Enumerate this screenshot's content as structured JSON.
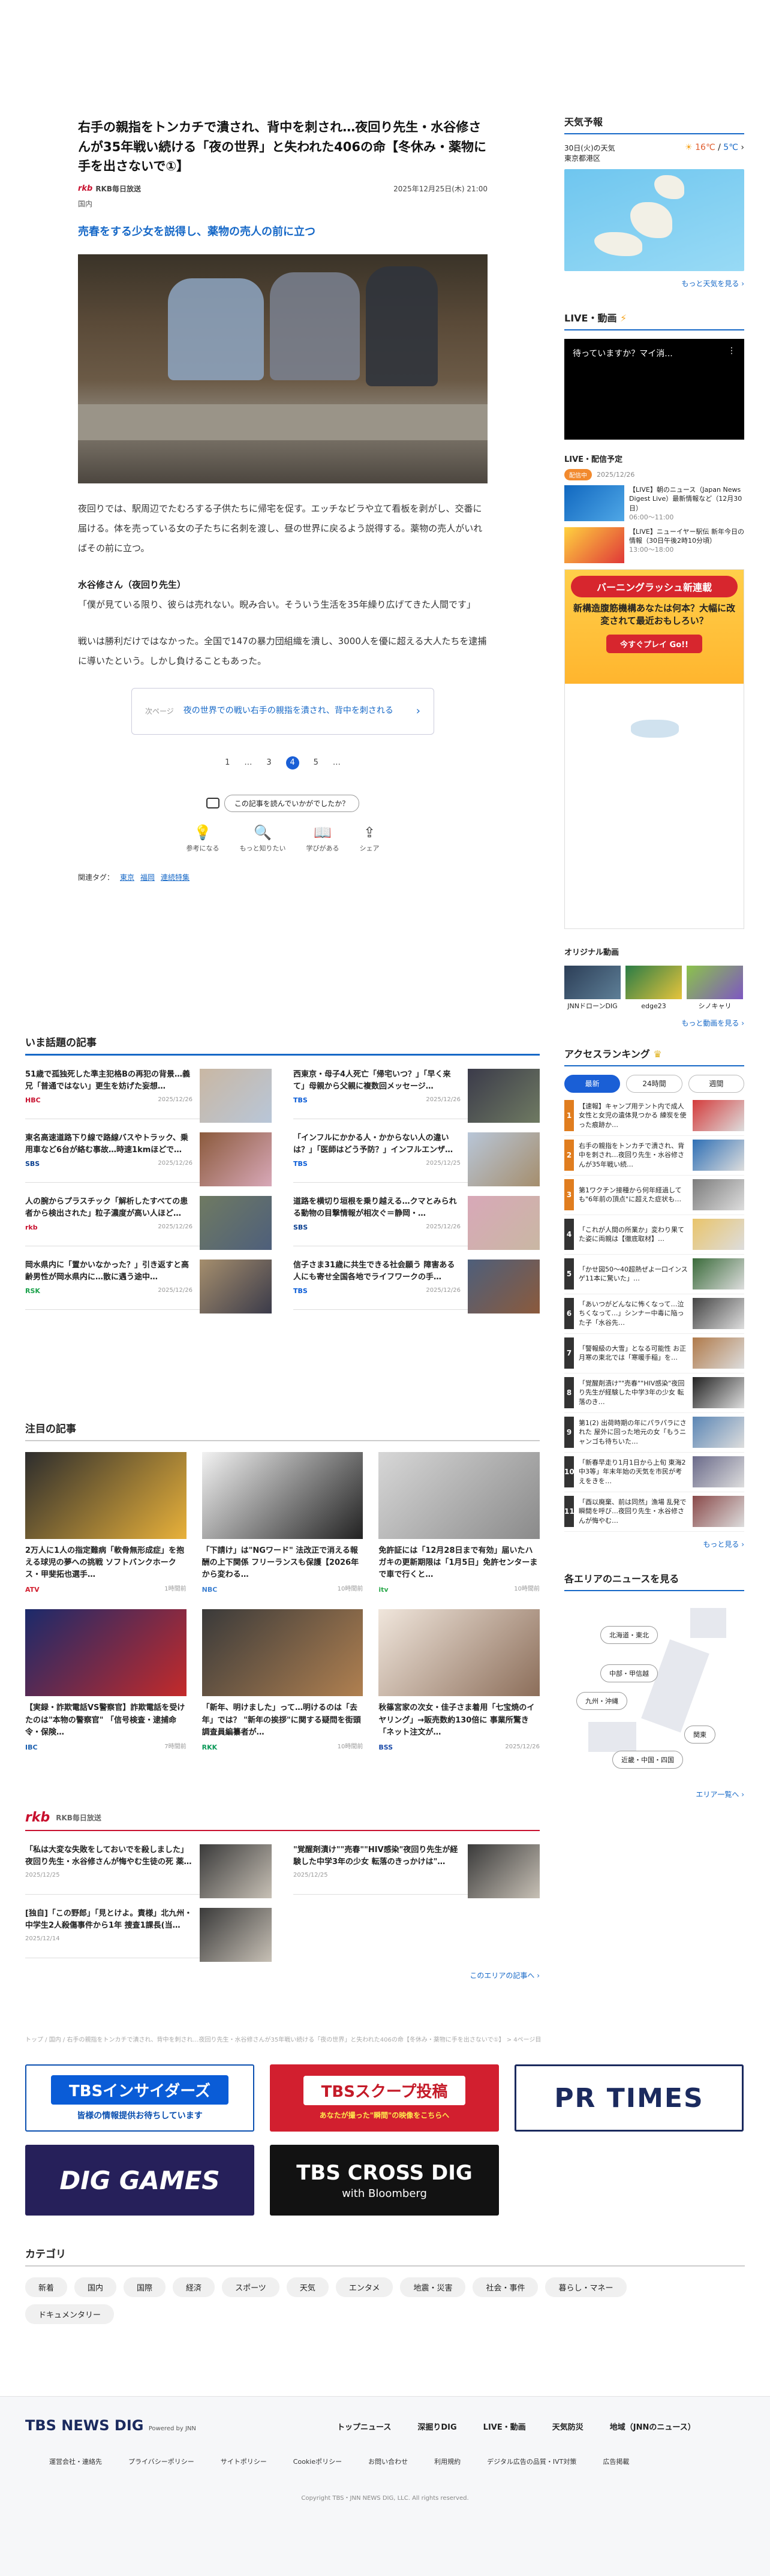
{
  "article": {
    "title": "右手の親指をトンカチで潰され、背中を刺され…夜回り先生・水谷修さんが35年戦い続ける「夜の世界」と失われた406の命【冬休み・薬物に手を出さないで①】",
    "source": "RKB毎日放送",
    "source_logo": "rkb",
    "date": "2025年12月25日(木) 21:00",
    "category": "国内",
    "subheading": "売春をする少女を説得し、薬物の売人の前に立つ",
    "paragraphs": [
      "夜回りでは、駅周辺でたむろする子供たちに帰宅を促す。エッチなビラや立て看板を剥がし、交番に届ける。体を売っている女の子たちに名刺を渡し、昼の世界に戻るよう説得する。薬物の売人がいればその前に立つ。",
      "「僕が見ている限り、彼らは売れない。睨み合い。そういう生活を35年繰り広げてきた人間です」",
      "戦いは勝利だけではなかった。全国で147の暴力団組織を潰し、3000人を優に超える大人たちを逮捕に導いたという。しかし負けることもあった。"
    ],
    "speaker": "水谷修さん（夜回り先生）",
    "next_label": "次ページ",
    "next_text": "夜の世界での戦い右手の親指を潰され、背中を刺される",
    "pages": [
      "1",
      "…",
      "3",
      "4",
      "5",
      "…"
    ],
    "current_page": "4",
    "reaction_q": "この記事を読んでいかがでしたか？",
    "reactions": [
      "参考になる",
      "もっと知りたい",
      "学びがある",
      "シェア"
    ],
    "tags_label": "関連タグ：",
    "tags": [
      "東京",
      "福岡",
      "連続特集"
    ]
  },
  "trending": {
    "title": "いま話題の記事",
    "items": [
      {
        "text": "51歳で孤独死した準主犯格Bの再犯の背景…義兄「普通ではない」更生を妨げた妄想…",
        "brand": "HBC",
        "date": "2025/12/26"
      },
      {
        "text": "西東京・母子4人死亡「帰宅いつ？」「早く来て」母親から父親に複数回メッセージ…",
        "brand": "TBS",
        "date": "2025/12/26"
      },
      {
        "text": "東名高速道路下り線で路線バスやトラック、乗用車など6台が絡む事故…時速1kmほどで…",
        "brand": "SBS",
        "date": "2025/12/26"
      },
      {
        "text": "「インフルにかかる人・かからない人の違いは？」「医師はどう予防？」インフルエンザ…",
        "brand": "TBS",
        "date": "2025/12/25"
      },
      {
        "text": "人の腕からプラスチック「解析したすべての患者から検出された」粒子濃度が高い人ほど…",
        "brand": "rkb",
        "date": "2025/12/26"
      },
      {
        "text": "道路を横切り垣根を乗り越える…クマとみられる動物の目撃情報が相次ぐ＝静岡・…",
        "brand": "SBS",
        "date": "2025/12/26"
      },
      {
        "text": "岡水県内に「置かいなかった？」引き返すと高齢男性が岡水県内に…散に遇う途中…",
        "brand": "RSK",
        "date": "2025/12/26"
      },
      {
        "text": "信子さま31歳に共生できる社会願う 障害ある人にも寄せ全国各地でライフワークの手…",
        "brand": "TBS",
        "date": "2025/12/26"
      }
    ]
  },
  "featured": {
    "title": "注目の記事",
    "items": [
      {
        "text": "2万人に1人の指定難病「軟骨無形成症」を抱える球児の夢への挑戦 ソフトバンクホークス・甲斐拓也選手…",
        "brand": "ATV",
        "date": "1時間前"
      },
      {
        "text": "「下請け」は\"NGワード\" 法改正で消える報酬の上下関係 フリーランスも保護【2026年から変わる…",
        "brand": "NBC",
        "date": "10時間前"
      },
      {
        "text": "免許証には「12月28日まで有効」届いたハガキの更新期限は「1月5日」免許センターまで車で行くと…",
        "brand": "itv",
        "date": "10時間前"
      },
      {
        "text": "【実録・詐欺電話VS警察官】詐欺電話を受けたのは\"本物の警察官\" 「信号検査・逮捕命令・保険…",
        "brand": "IBC",
        "date": "7時間前"
      },
      {
        "text": "「新年、明けました」って…明けるのは「去年」では？ \"新年の挨拶\"に関する疑問を街頭調査員編纂者が…",
        "brand": "RKK",
        "date": "10時間前"
      },
      {
        "text": "秋篠宮家の次女・佳子さま着用「七宝焼のイヤリング」→販売数約130倍に 事業所驚き「ネット注文が…",
        "brand": "BSS",
        "date": "2025/12/26"
      }
    ]
  },
  "rkb_section": {
    "label": "RKB毎日放送",
    "items": [
      {
        "text": "「私は大変な失敗をしておいでを殺しました」夜回り先生・水谷修さんが悔やむ生徒の死 薬…",
        "date": "2025/12/25"
      },
      {
        "text": "\"覚醒剤漬け\"\"売春\"\"HIV感染\"夜回り先生が経験した中学3年の少女 転落のきっかけは\"…",
        "date": "2025/12/25"
      },
      {
        "text": "[独自]「この野郎」「見とけよ。責様」北九州・中学生2人殺傷事件から1年 捜査1課長(当…",
        "date": "2025/12/14"
      }
    ],
    "more": "このエリアの記事へ"
  },
  "breadcrumb": "トップ / 国内 / 右手の親指をトンカチで潰され、背中を刺され…夜回り先生・水谷修さんが35年戦い続ける「夜の世界」と失われた406の命【冬休み・薬物に手を出さないで①】 > 4ページ目",
  "banners": {
    "insider": "TBSインサイダーズ",
    "insider_sub": "皆様の情報提供お待ちしています",
    "scoop": "TBSスクープ投稿",
    "scoop_sub": "あなたが撮った\"瞬間\"の映像をこちらへ",
    "prtimes": "PR TIMES",
    "diggames": "DIG GAMES",
    "crossdig": "TBS CROSS DIG",
    "crossdig_sub": "with Bloomberg"
  },
  "categories": {
    "title": "カテゴリ",
    "items": [
      "新着",
      "国内",
      "国際",
      "経済",
      "スポーツ",
      "天気",
      "エンタメ",
      "地震・災害",
      "社会・事件",
      "暮らし・マネー",
      "ドキュメンタリー"
    ]
  },
  "sidebar": {
    "weather_title": "天気予報",
    "weather_date": "30日(火)の天気",
    "weather_place": "東京都港区",
    "weather_hi": "16℃",
    "weather_lo": "5℃",
    "weather_more": "もっと天気を見る",
    "live_title": "LIVE・動画",
    "live_text": "待っていますか？マイ消...",
    "sched_title": "LIVE・配信予定",
    "sched_now": "配信中",
    "sched_date1": "2025/12/26",
    "sched_item1": "【LIVE】朝のニュース（Japan News Digest Live）最新情報など（12月30日）",
    "sched_time1": "06:00～11:00",
    "sched_item2": "【LIVE】ニューイヤー駅伝 新年今日の情報（30日午後2時10分頃）",
    "sched_time2": "13:00～18:00",
    "ad_l1": "バーニングラッシュ新連載",
    "ad_l2": "新構造腹筋機構あなたは何本？大幅に改変されて最近おもしろい？",
    "ad_l3": "今すぐプレイ Go!!",
    "video_title": "オリジナル動画",
    "videos": [
      "JNNドローンDIG",
      "edge23",
      "シノキャリ"
    ],
    "video_more": "もっと動画を見る",
    "rank_title": "アクセスランキング",
    "rank_tabs": [
      "最新",
      "24時間",
      "週間"
    ],
    "ranking": [
      "【速報】キャンプ用テント内で成人女性と女児の遺体見つかる 練炭を使った痕跡か…",
      "右手の親指をトンカチで潰され、背中を刺され…夜回り先生・水谷修さんが35年戦い続…",
      "第1ワクチン接種から何年経過しても\"6年前の頂点\"に超えた症状も…",
      "「これが人間の所業か」変わり果てた姿に両親は【徹底取材】…",
      "「かせ図50〜40超熱ぜよ一口インスゲ11本に驚いた」…",
      "「あいつがどんなに怖くなって…泣ちくなって…」シンナー中毒に陥った子「水谷先…",
      "「警報級の大雪」となる可能性 お正月寒の東北では「寒暖手稲」を…",
      "「覚醒剤漬け\"\"売春\"\"HIV感染\"夜回り先生が経験した中学3年の少女 転落のき…",
      "第1(2) 出荷時期の年にパラパラにされた 屋外に回った地元の女「もうニャンゴも待ちいた…",
      "「新春早走り1月1日から上旬 東海2中3等」年末年始の天気を市民が考えをきを…",
      "「酉以廃棄、前は同然」漁場 乱発で瞬間を呼び…夜回り先生・水谷修さんが悔やむ…"
    ],
    "rank_more": "もっと見る",
    "area_title": "各エリアのニュースを見る",
    "areas": [
      "北海道・東北",
      "中部・甲信越",
      "九州・沖縄",
      "関東",
      "近畿・中国・四国"
    ],
    "area_more": "エリア一覧へ"
  },
  "footer": {
    "logo": "TBS NEWS DIG",
    "logo_sub": "Powered by JNN",
    "nav": [
      "トップニュース",
      "深掘りDIG",
      "LIVE・動画",
      "天気防災",
      "地域（JNNのニュース）"
    ],
    "links": [
      "運営会社・連絡先",
      "プライバシーポリシー",
      "サイトポリシー",
      "Cookieポリシー",
      "お問い合わせ",
      "利用規約",
      "デジタル広告の品質・IVT対策",
      "広告掲載"
    ],
    "copyright": "Copyright TBS・JNN NEWS DIG, LLC. All rights reserved."
  },
  "colors": {
    "accent": "#1668c7",
    "current_page": "#1a5fd6",
    "rank_top": "#e07d1f"
  }
}
